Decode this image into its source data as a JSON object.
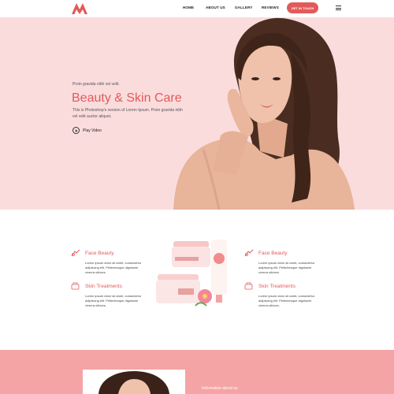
{
  "nav": {
    "items": [
      "HOME",
      "ABOUT US",
      "GALLERY",
      "REVIEWS"
    ],
    "cta": "GET IN TOUCH"
  },
  "hero": {
    "pretitle": "Proin gravida nibh vel velit.",
    "title": "Beauty & Skin Care",
    "description": "This is Photoshop's version  of Lorem Ipsum. Proin gravida nibh vel velit auctor aliquet.",
    "play_label": "Play Video"
  },
  "features": {
    "left_top": {
      "title": "Face Beauty",
      "text": "Lorem ipsum dolor sit amet, consectetur adipiscing elit. Pellentesque dignissim viverra ultrices."
    },
    "left_bottom": {
      "title": "Skin Treatments",
      "text": "Lorem ipsum dolor sit amet, consectetur adipiscing elit. Pellentesque dignissim viverra ultrices."
    },
    "right_top": {
      "title": "Face Beauty",
      "text": "Lorem ipsum dolor sit amet, consectetur adipiscing elit. Pellentesque dignissim viverra ultrices."
    },
    "right_bottom": {
      "title": "Skin Treatments",
      "text": "Lorem ipsum dolor sit amet, consectetur adipiscing elit. Pellentesque dignissim viverra ultrices."
    }
  },
  "band": {
    "text": "Information about us"
  },
  "colors": {
    "accent": "#e25a5a",
    "hero_bg": "#fbdcdd",
    "band_bg": "#f4a4a5"
  },
  "icons": [
    "logo-m-icon",
    "play-icon",
    "menu-icon",
    "face-beauty-icon",
    "skin-treatment-icon"
  ]
}
